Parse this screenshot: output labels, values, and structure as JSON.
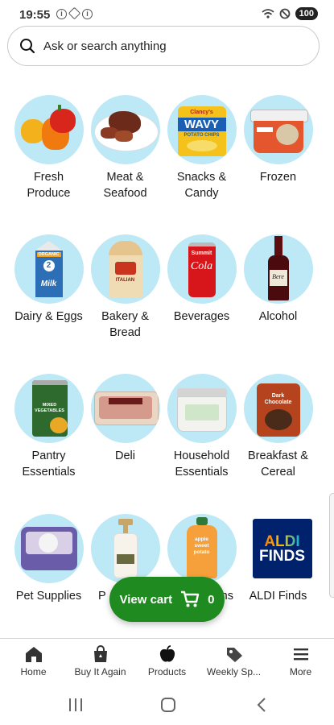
{
  "status": {
    "time": "19:55",
    "battery": "100"
  },
  "search": {
    "placeholder": "Ask or search anything"
  },
  "categories": [
    {
      "label": "Fresh\nProduce"
    },
    {
      "label": "Meat &\nSeafood"
    },
    {
      "label": "Snacks &\nCandy"
    },
    {
      "label": "Frozen"
    },
    {
      "label": "Dairy & Eggs"
    },
    {
      "label": "Bakery &\nBread"
    },
    {
      "label": "Beverages"
    },
    {
      "label": "Alcohol"
    },
    {
      "label": "Pantry\nEssentials"
    },
    {
      "label": "Deli"
    },
    {
      "label": "Household\nEssentials"
    },
    {
      "label": "Breakfast &\nCereal"
    },
    {
      "label": "Pet Supplies"
    },
    {
      "label": "P"
    },
    {
      "label": "ns"
    },
    {
      "label": "ALDI Finds"
    }
  ],
  "product_text": {
    "chips_brand": "Clancy's",
    "chips_name": "WAVY",
    "chips_sub": "POTATO CHIPS",
    "cola_brand": "Summit",
    "cola_name": "Cola",
    "wine_name": "Bere",
    "milk_brand": "ORGANIC",
    "milk_name": "Milk",
    "bread_name": "ITALIAN",
    "can_name": "MIXED VEGETABLES",
    "choc_name": "Dark Chocolate",
    "baby_food": "apple sweet potato",
    "aldi_finds_top": "ALDI",
    "aldi_finds_bottom": "FINDS"
  },
  "cart": {
    "label": "View cart",
    "count": "0"
  },
  "nav": [
    {
      "label": "Home"
    },
    {
      "label": "Buy It Again"
    },
    {
      "label": "Products"
    },
    {
      "label": "Weekly Sp..."
    },
    {
      "label": "More"
    }
  ],
  "colors": {
    "accent": "#1f8a1f",
    "circle": "#bde8f6",
    "aldi_blue": "#00216b"
  }
}
